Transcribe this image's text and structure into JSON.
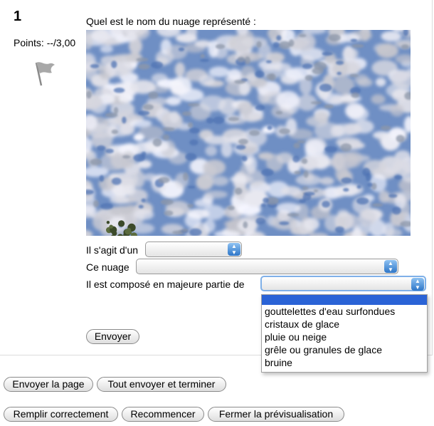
{
  "question": {
    "number": "1",
    "points": "Points: --/3,00",
    "text": "Quel est le nom du nuage représenté :"
  },
  "icons": {
    "flag": "flag-icon",
    "select_arrow": "updown-arrows-icon"
  },
  "fields": [
    {
      "label": "Il s'agit d'un",
      "value": ""
    },
    {
      "label": "Ce nuage",
      "value": ""
    },
    {
      "label": "Il est composé en majeure partie de",
      "value": ""
    }
  ],
  "dropdown": {
    "options": [
      "",
      "gouttelettes d'eau surfondues",
      "cristaux de glace",
      "pluie ou neige",
      "grêle ou granules de glace",
      "bruine"
    ],
    "selected_index": 0
  },
  "buttons": {
    "submit": "Envoyer",
    "submit_page": "Envoyer la page",
    "submit_all": "Tout envoyer et terminer",
    "fill_correct": "Remplir correctement",
    "restart": "Recommencer",
    "close_preview": "Fermer la prévisualisation"
  },
  "colors": {
    "accent": "#2a63d6",
    "select_arrow": "#2d76c8",
    "sky": "#5b84c4"
  }
}
